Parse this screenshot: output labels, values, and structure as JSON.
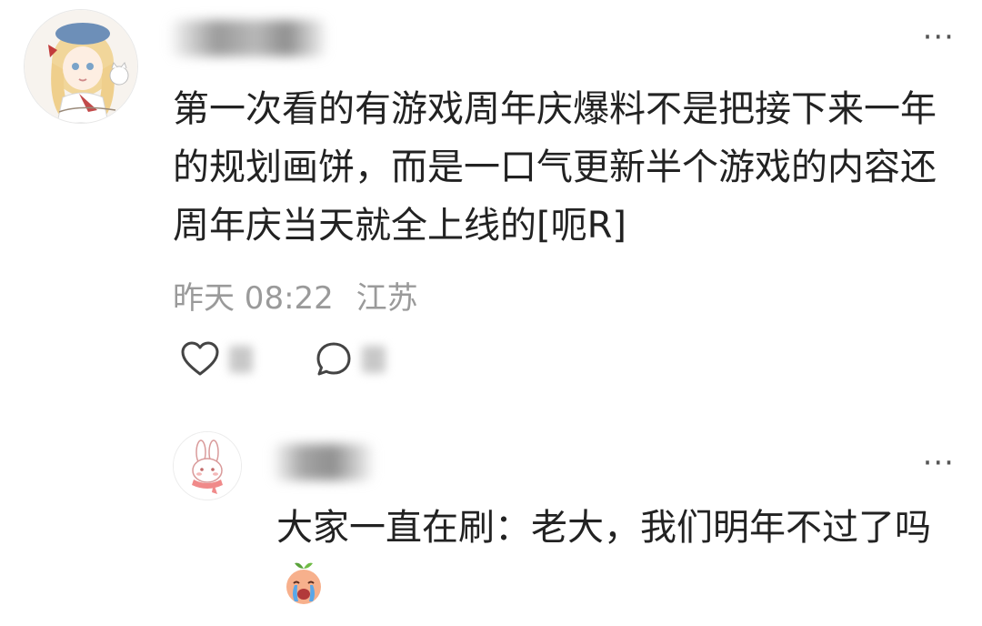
{
  "main_comment": {
    "text": "第一次看的有游戏周年庆爆料不是把接下来一年的规划画饼，而是一口气更新半个游戏的内容还周年庆当天就全上线的[呃R]",
    "time": "昨天 08:22",
    "location": "江苏",
    "more_label": "···",
    "icons": [
      "heart-icon",
      "comment-icon"
    ]
  },
  "reply": {
    "text": "大家一直在刷：老大，我们明年不过了吗",
    "more_label": "···",
    "emoji": "crying-emoji"
  },
  "colors": {
    "text": "#222222",
    "meta": "#9a9a9a",
    "icon": "#444444"
  }
}
